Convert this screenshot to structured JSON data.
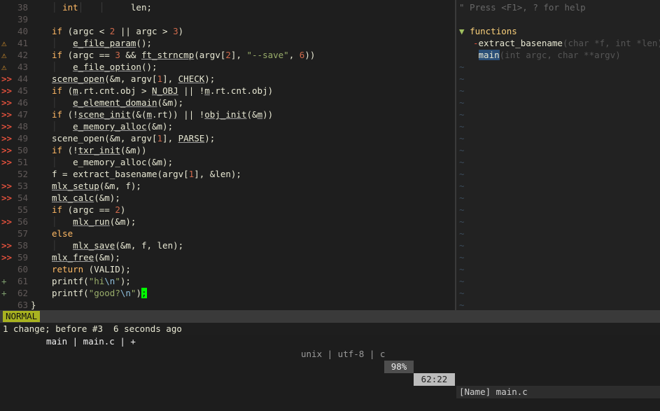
{
  "editor": {
    "lines": [
      {
        "num": "38",
        "sign": "",
        "segs": [
          [
            "g",
            "│ "
          ],
          [
            "ty",
            "int"
          ],
          [
            "g",
            "│   │  "
          ],
          [
            "",
            "   len;"
          ]
        ]
      },
      {
        "num": "39",
        "sign": "",
        "segs": []
      },
      {
        "num": "40",
        "sign": "",
        "segs": [
          [
            "kw",
            "if"
          ],
          [
            "",
            " (argc < "
          ],
          [
            "n",
            "2"
          ],
          [
            "",
            " || argc > "
          ],
          [
            "n",
            "3"
          ],
          [
            "",
            ")"
          ]
        ]
      },
      {
        "num": "41",
        "sign": "⚠",
        "signType": "warn",
        "segs": [
          [
            "g",
            "│   "
          ],
          [
            "u",
            "e_file_param"
          ],
          [
            "",
            "();"
          ]
        ]
      },
      {
        "num": "42",
        "sign": "⚠",
        "signType": "warn",
        "segs": [
          [
            "kw",
            "if"
          ],
          [
            "",
            " (argc == "
          ],
          [
            "n",
            "3"
          ],
          [
            "",
            " && "
          ],
          [
            "u",
            "ft_strncmp"
          ],
          [
            "",
            "(argv["
          ],
          [
            "n",
            "2"
          ],
          [
            "",
            "], "
          ],
          [
            "s",
            "\"--save\""
          ],
          [
            "",
            ", "
          ],
          [
            "n",
            "6"
          ],
          [
            "",
            "))"
          ]
        ]
      },
      {
        "num": "43",
        "sign": "⚠",
        "signType": "warn",
        "segs": [
          [
            "g",
            "│   "
          ],
          [
            "u",
            "e_file_option"
          ],
          [
            "",
            "();"
          ]
        ]
      },
      {
        "num": "44",
        "sign": ">>",
        "signType": "err",
        "segs": [
          [
            "u",
            "scene_open"
          ],
          [
            "",
            "(&m, argv["
          ],
          [
            "n",
            "1"
          ],
          [
            "",
            "], "
          ],
          [
            "u",
            "CHECK"
          ],
          [
            "",
            ");"
          ]
        ]
      },
      {
        "num": "45",
        "sign": ">>",
        "signType": "err",
        "segs": [
          [
            "kw",
            "if"
          ],
          [
            "",
            " ("
          ],
          [
            "u",
            "m"
          ],
          [
            "",
            ".rt.cnt.obj > "
          ],
          [
            "u",
            "N_OBJ"
          ],
          [
            "",
            " || !"
          ],
          [
            "u",
            "m"
          ],
          [
            "",
            ".rt.cnt.obj)"
          ]
        ]
      },
      {
        "num": "46",
        "sign": ">>",
        "signType": "err",
        "segs": [
          [
            "g",
            "│   "
          ],
          [
            "u",
            "e_element_domain"
          ],
          [
            "",
            "(&m);"
          ]
        ]
      },
      {
        "num": "47",
        "sign": ">>",
        "signType": "err",
        "segs": [
          [
            "kw",
            "if"
          ],
          [
            "",
            " (!"
          ],
          [
            "u",
            "scene_init"
          ],
          [
            "",
            "(&("
          ],
          [
            "u",
            "m"
          ],
          [
            "",
            ".rt)) || !"
          ],
          [
            "u",
            "obj_init"
          ],
          [
            "",
            "(&"
          ],
          [
            "u",
            "m"
          ],
          [
            "",
            "))"
          ]
        ]
      },
      {
        "num": "48",
        "sign": ">>",
        "signType": "err",
        "segs": [
          [
            "g",
            "│   "
          ],
          [
            "u",
            "e_memory_alloc"
          ],
          [
            "",
            "(&m);"
          ]
        ]
      },
      {
        "num": "49",
        "sign": ">>",
        "signType": "err",
        "segs": [
          [
            "",
            "scene_open(&m, argv["
          ],
          [
            "n",
            "1"
          ],
          [
            "",
            "], "
          ],
          [
            "u",
            "PARSE"
          ],
          [
            "",
            ");"
          ]
        ]
      },
      {
        "num": "50",
        "sign": ">>",
        "signType": "err",
        "segs": [
          [
            "kw",
            "if"
          ],
          [
            "",
            " (!"
          ],
          [
            "u",
            "txr_init"
          ],
          [
            "",
            "(&m))"
          ]
        ]
      },
      {
        "num": "51",
        "sign": ">>",
        "signType": "err",
        "segs": [
          [
            "g",
            "│   "
          ],
          [
            "",
            "e_memory_alloc(&m);"
          ]
        ]
      },
      {
        "num": "52",
        "sign": "",
        "segs": [
          [
            "",
            "f = extract_basename(argv["
          ],
          [
            "n",
            "1"
          ],
          [
            "",
            "], &len);"
          ]
        ]
      },
      {
        "num": "53",
        "sign": ">>",
        "signType": "err",
        "segs": [
          [
            "u",
            "mlx_setup"
          ],
          [
            "",
            "(&m, f);"
          ]
        ]
      },
      {
        "num": "54",
        "sign": ">>",
        "signType": "err",
        "segs": [
          [
            "u",
            "mlx_calc"
          ],
          [
            "",
            "(&m);"
          ]
        ]
      },
      {
        "num": "55",
        "sign": "",
        "segs": [
          [
            "kw",
            "if"
          ],
          [
            "",
            " (argc == "
          ],
          [
            "n",
            "2"
          ],
          [
            "",
            ")"
          ]
        ]
      },
      {
        "num": "56",
        "sign": ">>",
        "signType": "err",
        "segs": [
          [
            "g",
            "│   "
          ],
          [
            "u",
            "mlx_run"
          ],
          [
            "",
            "(&m);"
          ]
        ]
      },
      {
        "num": "57",
        "sign": "",
        "segs": [
          [
            "kw",
            "else"
          ]
        ]
      },
      {
        "num": "58",
        "sign": ">>",
        "signType": "err",
        "segs": [
          [
            "g",
            "│   "
          ],
          [
            "u",
            "mlx_save"
          ],
          [
            "",
            "(&m, f, len);"
          ]
        ]
      },
      {
        "num": "59",
        "sign": ">>",
        "signType": "err",
        "segs": [
          [
            "u",
            "mlx_free"
          ],
          [
            "",
            "(&m);"
          ]
        ]
      },
      {
        "num": "60",
        "sign": "",
        "segs": [
          [
            "kw",
            "return"
          ],
          [
            "",
            " (VALID);"
          ]
        ]
      },
      {
        "num": "61",
        "sign": "+",
        "signType": "add",
        "segs": [
          [
            "",
            "printf("
          ],
          [
            "s",
            "\"hi"
          ],
          [
            "esc",
            "\\n"
          ],
          [
            "s",
            "\""
          ],
          [
            "",
            ");"
          ]
        ]
      },
      {
        "num": "62",
        "sign": "+",
        "signType": "add",
        "segs": [
          [
            "",
            "printf("
          ],
          [
            "s",
            "\"good?"
          ],
          [
            "esc",
            "\\n"
          ],
          [
            "s",
            "\""
          ],
          [
            "",
            ")"
          ],
          [
            "cur",
            ";"
          ]
        ]
      },
      {
        "num": "63",
        "sign": "",
        "segs": [
          [
            "",
            "}"
          ]
        ],
        "close": true
      }
    ]
  },
  "tagbar": {
    "help": "\" Press <F1>, ? for help",
    "group_fold": "▼",
    "group_name": "functions",
    "tags": [
      {
        "prefix": "-",
        "name": "extract_basename",
        "sig": "(char *f, int *len)"
      },
      {
        "prefix": " ",
        "name": "main",
        "sig": "(int argc, char **argv)",
        "selected": true
      }
    ],
    "tilde": "~"
  },
  "statusline": {
    "mode": "NORMAL",
    "file": "main | main.c | +",
    "format": "unix | utf-8 | c",
    "percent": "98%",
    "position": "62:22",
    "tagbar_status": "[Name] main.c"
  },
  "cmdline": "1 change; before #3  6 seconds ago",
  "colors": {
    "mode_bg": "#a8b220",
    "error_sign": "#e0503c",
    "warn_sign": "#d6912d",
    "cursor": "#00ff00"
  }
}
